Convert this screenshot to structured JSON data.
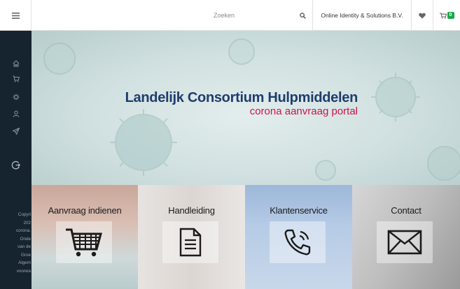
{
  "topbar": {
    "menu_icon": "hamburger-menu-icon",
    "search_placeholder": "Zoeken",
    "search_icon": "search-icon",
    "account_label": "Online Identity & Solutions B.V.",
    "wishlist_icon": "heart-icon",
    "cart_icon": "cart-icon",
    "cart_count": "0"
  },
  "sidebar": {
    "icons": [
      "home-icon",
      "cart-icon",
      "virus-icon",
      "user-icon",
      "send-icon",
      "logout-icon"
    ],
    "footer_lines": [
      "Copyri",
      "202",
      "corona.",
      "Onde",
      "van de",
      "Groe",
      "Algem",
      "voorwa"
    ]
  },
  "hero": {
    "title": "Landelijk Consortium Hulpmiddelen",
    "subtitle": "corona aanvraag portal"
  },
  "tiles": [
    {
      "label": "Aanvraag indienen",
      "icon": "shopping-cart-icon"
    },
    {
      "label": "Handleiding",
      "icon": "document-icon"
    },
    {
      "label": "Klantenservice",
      "icon": "phone-icon"
    },
    {
      "label": "Contact",
      "icon": "envelope-icon"
    }
  ],
  "colors": {
    "sidebar": "#16242f",
    "title": "#1f3d6c",
    "subtitle": "#c8164a",
    "cart_badge": "#18a84a"
  }
}
